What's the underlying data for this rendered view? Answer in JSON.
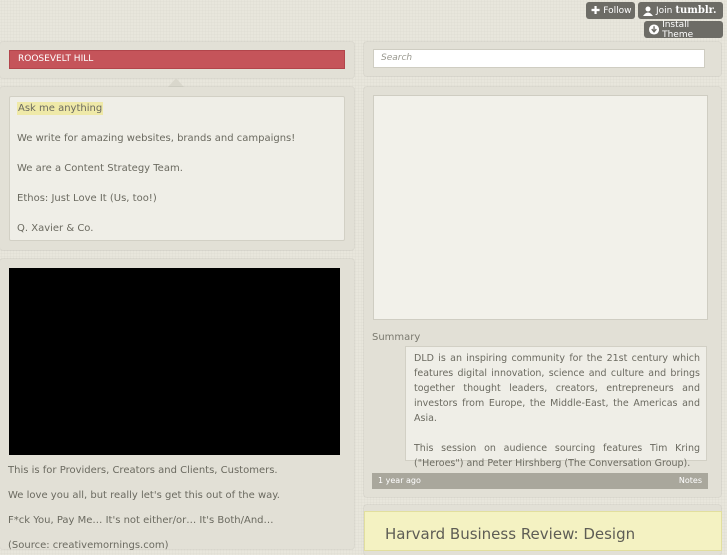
{
  "tumblr_bar": {
    "follow_label": "Follow",
    "join_label": "Join",
    "join_brand": "tumblr.",
    "install_label": "Install Theme"
  },
  "blog": {
    "title": "ROOSEVELT HILL",
    "ask_label": "Ask me anything",
    "description": [
      "We write for amazing websites, brands and campaigns!",
      "We are a Content Strategy Team.",
      "Ethos: Just Love It (Us, too!)",
      "Q. Xavier & Co."
    ]
  },
  "video_post": {
    "lines": [
      "This is for Providers, Creators and Clients, Customers.",
      "We love you all, but really let's get this out of the way.",
      "F*ck You, Pay Me… It's not either/or… It's Both/And…",
      "(Source: creativemornings.com)"
    ]
  },
  "search": {
    "placeholder": "Search"
  },
  "photo_post": {
    "summary_label": "Summary",
    "paragraphs": [
      "DLD is an inspiring community for the 21st century which features digital innovation, science and culture and brings together thought leaders, creators, entrepreneurs and investors from Europe, the Middle-East, the Americas and Asia.",
      "This session on audience sourcing features Tim Kring (\"Heroes\") and Peter Hirshberg (The Conversation Group)."
    ],
    "timestamp": "1 year ago",
    "notes_label": "Notes"
  },
  "next_post": {
    "title": "Harvard Business Review: Design"
  }
}
